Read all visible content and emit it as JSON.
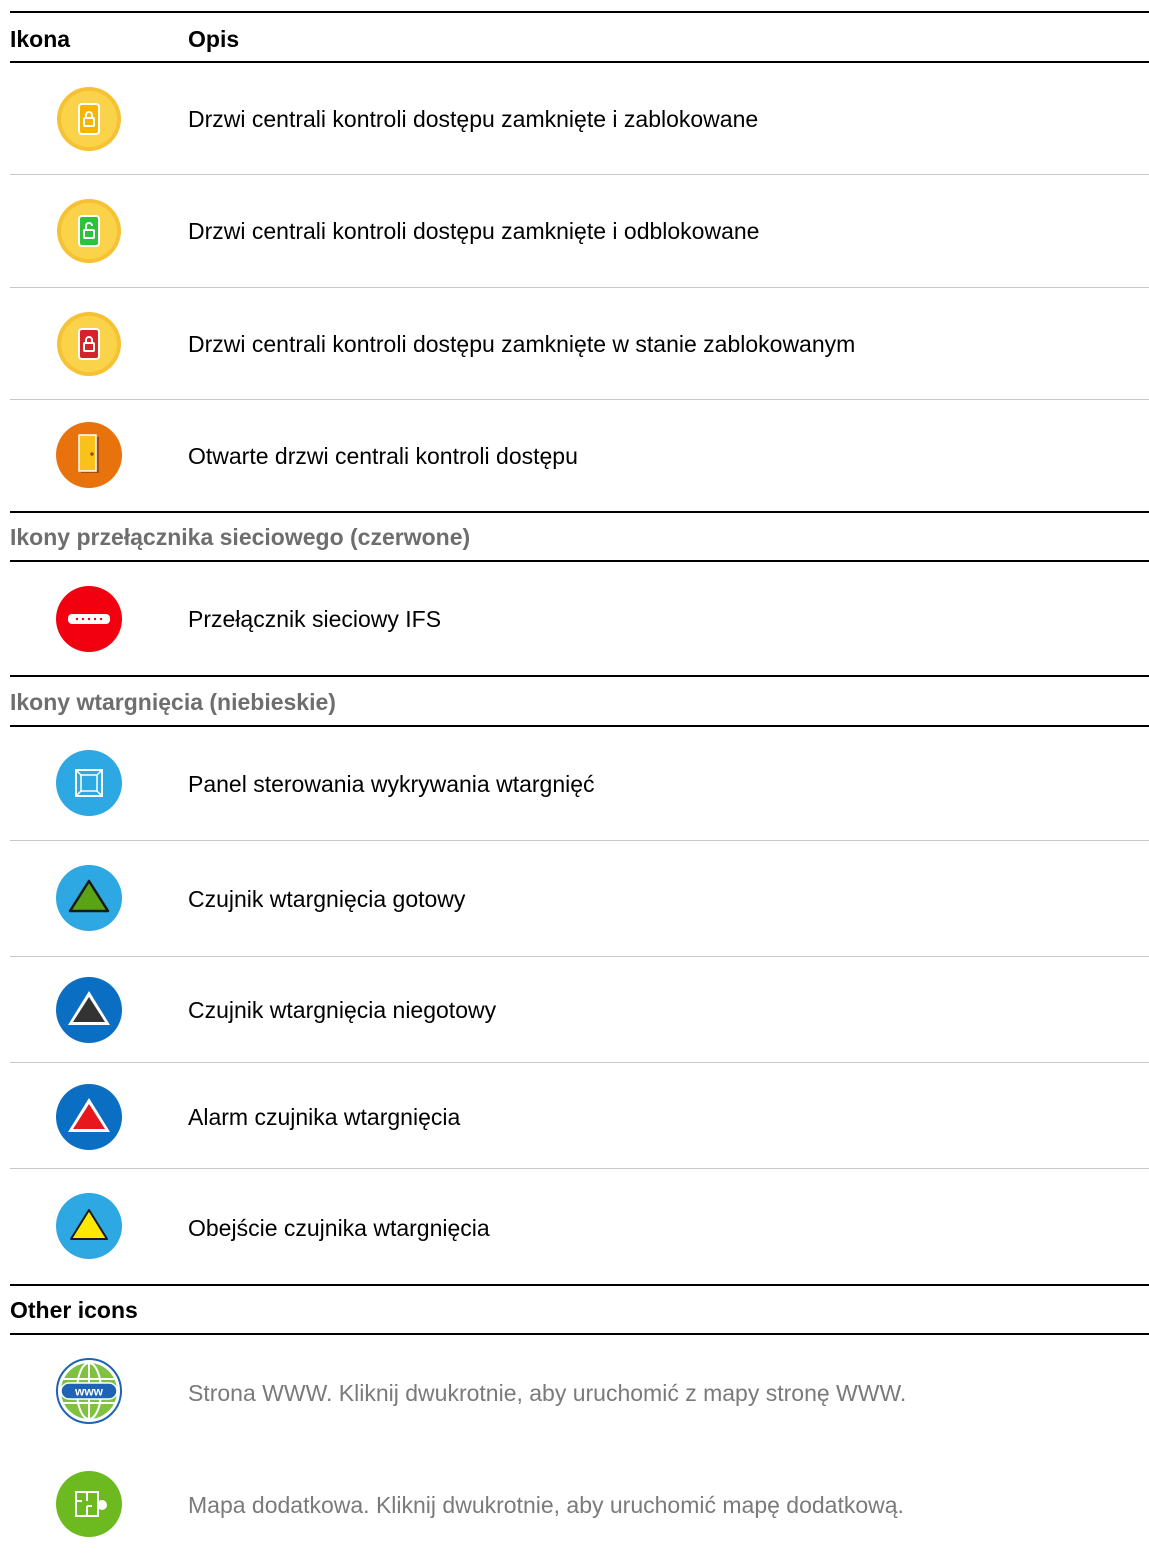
{
  "header": {
    "col_icon": "Ikona",
    "col_desc": "Opis"
  },
  "rows_door": [
    {
      "icon": "door-locked-icon",
      "text": "Drzwi centrali kontroli dostępu zamknięte i zablokowane"
    },
    {
      "icon": "door-unlocked-icon",
      "text": "Drzwi centrali kontroli dostępu zamknięte i odblokowane"
    },
    {
      "icon": "door-lockdown-icon",
      "text": "Drzwi centrali kontroli dostępu zamknięte w stanie zablokowanym"
    },
    {
      "icon": "door-open-icon",
      "text": "Otwarte drzwi centrali kontroli dostępu"
    }
  ],
  "section_switch": {
    "title": "Ikony przełącznika sieciowego (czerwone)"
  },
  "rows_switch": [
    {
      "icon": "network-switch-icon",
      "text": "Przełącznik sieciowy IFS"
    }
  ],
  "section_intrusion": {
    "title": "Ikony wtargnięcia (niebieskie)"
  },
  "rows_intrusion": [
    {
      "icon": "intrusion-panel-icon",
      "text": "Panel sterowania wykrywania wtargnięć"
    },
    {
      "icon": "sensor-ready-icon",
      "text": "Czujnik wtargnięcia gotowy"
    },
    {
      "icon": "sensor-not-ready-icon",
      "text": "Czujnik wtargnięcia niegotowy"
    },
    {
      "icon": "sensor-alarm-icon",
      "text": "Alarm czujnika wtargnięcia"
    },
    {
      "icon": "sensor-bypass-icon",
      "text": "Obejście czujnika wtargnięcia"
    }
  ],
  "section_other": {
    "title": "Other icons"
  },
  "rows_other": [
    {
      "icon": "www-globe-icon",
      "icon_label": "www",
      "text": "Strona WWW. Kliknij dwukrotnie, aby uruchomić z mapy stronę WWW."
    },
    {
      "icon": "submap-icon",
      "text": "Mapa dodatkowa. Kliknij dwukrotnie, aby uruchomić mapę dodatkową."
    }
  ],
  "colors": {
    "door_ring": "#fbd34a",
    "door_ring_outer": "#f6c233",
    "door_locked": "#f7b500",
    "door_unlocked": "#2cc33a",
    "door_lockdown": "#d6232a",
    "door_open_bg": "#e8720c",
    "door_open_leaf": "#f9c21a",
    "switch_red": "#f2000f",
    "intrusion_blue": "#2ea8e3",
    "intrusion_dark_blue": "#0a6ec2",
    "triangle_green": "#5aa315",
    "triangle_dark": "#333333",
    "triangle_red": "#e8161d",
    "triangle_yellow": "#ffe800",
    "www_green": "#7fc242",
    "www_blue": "#1e63b4",
    "submap_green": "#6cba1f"
  }
}
